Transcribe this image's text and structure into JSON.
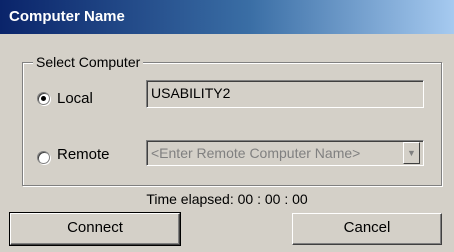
{
  "window": {
    "title": "Computer Name"
  },
  "group": {
    "legend": "Select Computer",
    "local": {
      "label": "Local",
      "selected": true,
      "value": "USABILITY2"
    },
    "remote": {
      "label": "Remote",
      "selected": false,
      "placeholder": "<Enter Remote Computer Name>"
    }
  },
  "status": {
    "elapsed": "Time elapsed:  00 : 00 : 00"
  },
  "buttons": {
    "connect": "Connect",
    "cancel": "Cancel"
  },
  "icons": {
    "radio_selected": "radio-dot",
    "dropdown": "chevron-down-icon"
  }
}
